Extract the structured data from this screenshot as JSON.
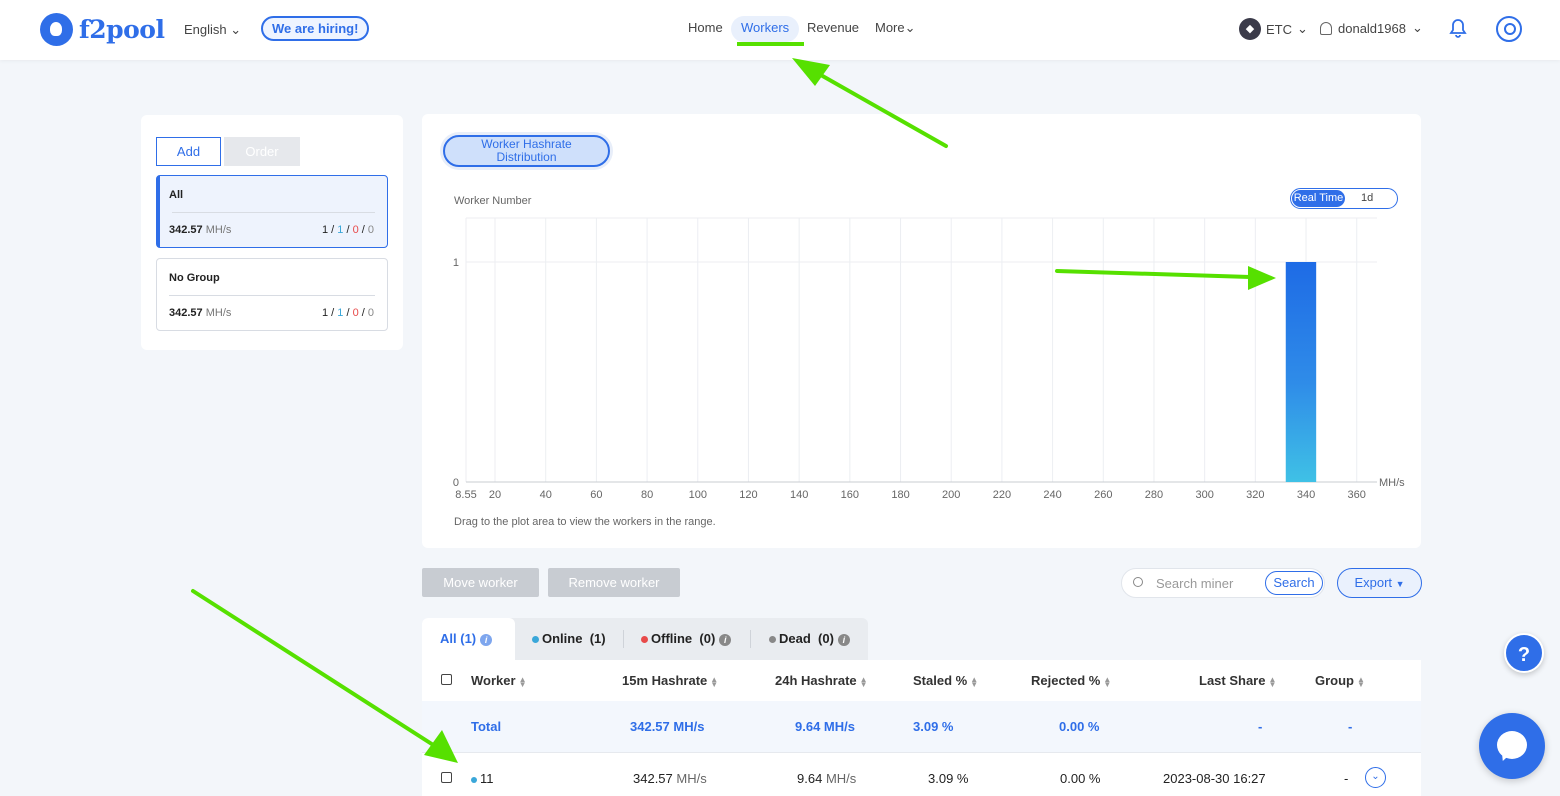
{
  "header": {
    "logo_text": "f2pool",
    "language": "English",
    "hiring": "We are hiring!",
    "nav": {
      "home": "Home",
      "workers": "Workers",
      "revenue": "Revenue",
      "more": "More"
    },
    "coin": "ETC",
    "username": "donald1968"
  },
  "groups": {
    "add_label": "Add",
    "order_label": "Order",
    "items": [
      {
        "name": "All",
        "hashrate": "342.57",
        "unit": "MH/s",
        "total": "1",
        "online": "1",
        "offline": "0",
        "dead": "0"
      },
      {
        "name": "No Group",
        "hashrate": "342.57",
        "unit": "MH/s",
        "total": "1",
        "online": "1",
        "offline": "0",
        "dead": "0"
      }
    ]
  },
  "chart_panel": {
    "tab_line1": "Worker Hashrate",
    "tab_line2": "Distribution",
    "toggle_realtime": "Real Time",
    "toggle_1d": "1d",
    "footnote": "Drag to the plot area to view the workers in the range."
  },
  "chart_data": {
    "type": "bar",
    "title": "",
    "ylabel": "Worker Number",
    "xlabel": "MH/s",
    "x_ticks": [
      "8.55",
      "20",
      "40",
      "60",
      "80",
      "100",
      "120",
      "140",
      "160",
      "180",
      "200",
      "220",
      "240",
      "260",
      "280",
      "300",
      "320",
      "340",
      "360"
    ],
    "y_ticks": [
      "0",
      "1"
    ],
    "xlim": [
      8.55,
      368
    ],
    "ylim": [
      0,
      1.2
    ],
    "bars": [
      {
        "x_start": 332,
        "x_end": 344,
        "value": 1
      }
    ],
    "bar_colors": [
      "#1e6be6",
      "#3fc1e6"
    ],
    "grid": true
  },
  "actions": {
    "move_worker": "Move worker",
    "remove_worker": "Remove worker",
    "search_placeholder": "Search miner",
    "search_button": "Search",
    "export": "Export"
  },
  "tabs": {
    "all": "All",
    "all_count": "(1)",
    "online": "Online",
    "online_count": "(1)",
    "offline": "Offline",
    "offline_count": "(0)",
    "dead": "Dead",
    "dead_count": "(0)"
  },
  "table": {
    "headers": {
      "worker": "Worker",
      "h15m": "15m Hashrate",
      "h24h": "24h Hashrate",
      "staled": "Staled %",
      "rejected": "Rejected %",
      "last_share": "Last Share",
      "group": "Group"
    },
    "total": {
      "label": "Total",
      "h15m": "342.57 MH/s",
      "h24h": "9.64 MH/s",
      "staled": "3.09 %",
      "rejected": "0.00 %",
      "last_share": "-",
      "group": "-"
    },
    "rows": [
      {
        "worker": "11",
        "h15m": "342.57",
        "h15m_unit": "MH/s",
        "h24h": "9.64",
        "h24h_unit": "MH/s",
        "staled": "3.09 %",
        "rejected": "0.00 %",
        "last_share": "2023-08-30 16:27",
        "group": "-"
      }
    ]
  },
  "colors": {
    "accent": "#2f6ee8",
    "annotation_arrow": "#56e000",
    "online": "#3aa7d9",
    "offline": "#e84a4a"
  }
}
